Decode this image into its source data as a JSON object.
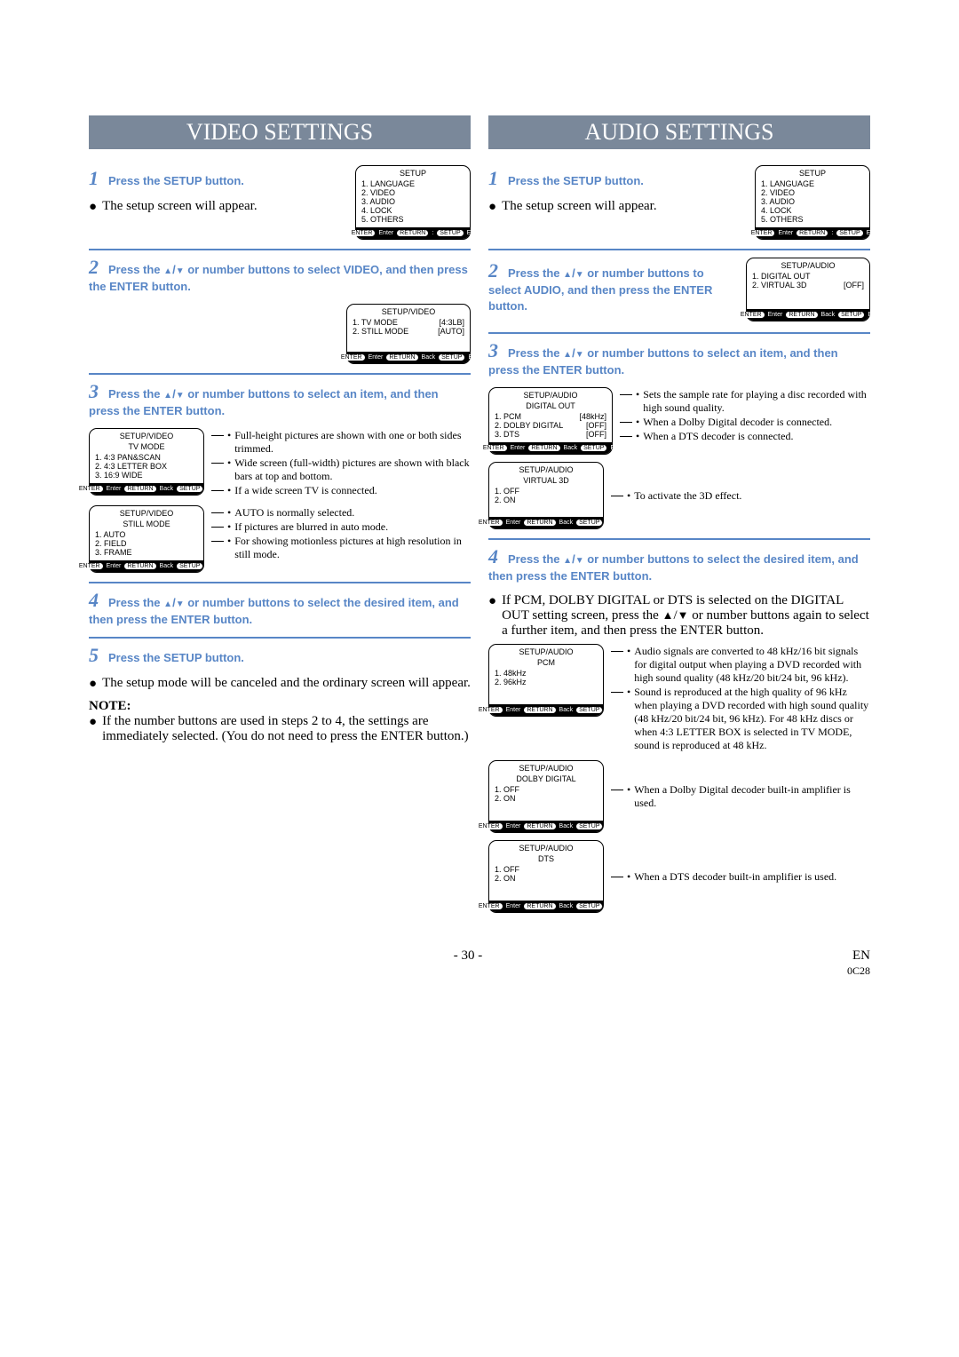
{
  "left": {
    "banner": "VIDEO SETTINGS",
    "s1": {
      "num": "1",
      "head": "Press the SETUP button.",
      "body": "The setup screen will appear."
    },
    "osd_setup": {
      "title": "SETUP",
      "i1": "1. LANGUAGE",
      "i2": "2. VIDEO",
      "i3": "3. AUDIO",
      "i4": "4. LOCK",
      "i5": "5. OTHERS",
      "f_enter": "ENTER",
      "f_enter_t": "Enter",
      "f_return": "RETURN",
      "f_dash": ":",
      "f_setup": "SETUP",
      "f_exit": "Exit"
    },
    "s2": {
      "num": "2",
      "head_a": "Press the ",
      "head_b": " or number buttons to select VIDEO, and then press the ENTER button."
    },
    "osd_video": {
      "title": "SETUP/VIDEO",
      "r1a": "1. TV MODE",
      "r1b": "[4:3LB]",
      "r2a": "2. STILL MODE",
      "r2b": "[AUTO]",
      "f_enter": "ENTER",
      "f_enter_t": "Enter",
      "f_return": "RETURN",
      "f_back": "Back",
      "f_setup": "SETUP",
      "f_exit": "Exit"
    },
    "s3": {
      "num": "3",
      "head_a": "Press the ",
      "head_b": " or number buttons to select an item, and then press the ENTER button."
    },
    "osd_tvmode": {
      "title1": "SETUP/VIDEO",
      "title2": "TV MODE",
      "i1": "1. 4:3 PAN&SCAN",
      "i2": "2. 4:3 LETTER BOX",
      "i3": "3. 16:9 WIDE"
    },
    "tvmode_exp": {
      "e1": "Full-height pictures are shown with one or both sides trimmed.",
      "e2": "Wide screen (full-width) pictures are shown with black bars at top and bottom.",
      "e3": "If a wide screen TV is connected."
    },
    "osd_still": {
      "title1": "SETUP/VIDEO",
      "title2": "STILL MODE",
      "i1": "1. AUTO",
      "i2": "2. FIELD",
      "i3": "3. FRAME"
    },
    "still_exp": {
      "e1": "AUTO is normally selected.",
      "e2": "If pictures are blurred in auto mode.",
      "e3": "For showing motionless pictures at high resolution in still mode."
    },
    "s4": {
      "num": "4",
      "head_a": "Press the ",
      "head_b": " or number buttons to select the desired item, and then press the ENTER button."
    },
    "s5": {
      "num": "5",
      "head": "Press the SETUP button.",
      "body": "The setup mode will be canceled and the ordinary screen will appear."
    },
    "note_h": "NOTE:",
    "note_b": "If the number buttons are used in steps 2 to 4, the settings are immediately selected. (You do not need to press the ENTER button.)"
  },
  "right": {
    "banner": "AUDIO SETTINGS",
    "s1": {
      "num": "1",
      "head": "Press the SETUP button.",
      "body": "The setup screen will appear."
    },
    "osd_setup": {
      "title": "SETUP",
      "i1": "1. LANGUAGE",
      "i2": "2. VIDEO",
      "i3": "3. AUDIO",
      "i4": "4. LOCK",
      "i5": "5. OTHERS"
    },
    "s2": {
      "num": "2",
      "head_a": "Press the ",
      "head_b": " or number buttons to select AUDIO, and then press the ENTER button."
    },
    "osd_audio": {
      "title": "SETUP/AUDIO",
      "r1a": "1. DIGITAL OUT",
      "r1b": "",
      "r2a": "2. VIRTUAL 3D",
      "r2b": "[OFF]"
    },
    "s3": {
      "num": "3",
      "head_a": "Press the ",
      "head_b": " or number buttons to select an item, and then press the ENTER button."
    },
    "osd_digout": {
      "title1": "SETUP/AUDIO",
      "title2": "DIGITAL OUT",
      "r1a": "1. PCM",
      "r1b": "[48kHz]",
      "r2a": "2. DOLBY DIGITAL",
      "r2b": "[OFF]",
      "r3a": "3. DTS",
      "r3b": "[OFF]"
    },
    "digout_exp": {
      "e1": "Sets the sample rate for playing a disc recorded with high sound quality.",
      "e2": "When a Dolby Digital decoder is connected.",
      "e3": "When a DTS decoder is connected."
    },
    "osd_v3d": {
      "title1": "SETUP/AUDIO",
      "title2": "VIRTUAL 3D",
      "i1": "1. OFF",
      "i2": "2. ON"
    },
    "v3d_exp": {
      "e1": "To activate the 3D effect."
    },
    "s4": {
      "num": "4",
      "head_a": "Press the ",
      "head_b": " or number buttons to select the desired item, and then press the ENTER button."
    },
    "s4_body_a": "If PCM, DOLBY DIGITAL or DTS is selected on the DIGITAL OUT setting screen, press the ",
    "s4_body_b": " or number buttons again to select a further item, and then press the ENTER button.",
    "osd_pcm": {
      "title1": "SETUP/AUDIO",
      "title2": "PCM",
      "i1": "1. 48kHz",
      "i2": "2. 96kHz"
    },
    "pcm_exp": {
      "e1": "Audio signals are converted to 48 kHz/16 bit signals for digital output when playing a DVD recorded with high sound quality (48 kHz/20 bit/24 bit, 96 kHz).",
      "e2": "Sound is reproduced at the high quality of 96 kHz when playing a DVD recorded with high sound quality (48 kHz/20 bit/24 bit, 96 kHz). For 48 kHz discs or when 4:3 LETTER BOX is selected in TV MODE, sound is reproduced at 48 kHz."
    },
    "osd_dolby": {
      "title1": "SETUP/AUDIO",
      "title2": "DOLBY DIGITAL",
      "i1": "1. OFF",
      "i2": "2. ON"
    },
    "dolby_exp": {
      "e1": "When a Dolby Digital decoder built-in amplifier is used."
    },
    "osd_dts": {
      "title1": "SETUP/AUDIO",
      "title2": "DTS",
      "i1": "1. OFF",
      "i2": "2. ON"
    },
    "dts_exp": {
      "e1": "When a DTS decoder built-in amplifier is used."
    }
  },
  "footer": {
    "page": "- 30 -",
    "lang": "EN",
    "code": "0C28"
  },
  "foot_keys": {
    "enter": "ENTER",
    "enter_t": "Enter",
    "return": "RETURN",
    "back": "Back",
    "setup": "SETUP",
    "exit": "Exit"
  }
}
